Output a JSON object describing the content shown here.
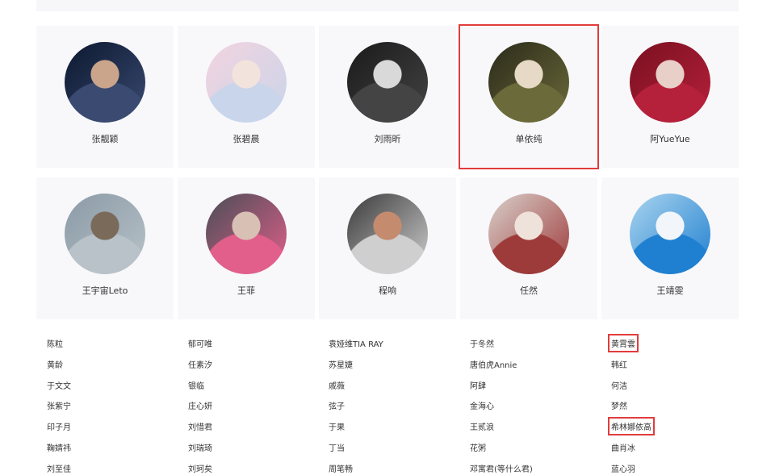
{
  "accent_highlight": "#e23c3c",
  "featured_row_1": [
    {
      "name": "张靓颖",
      "avatar_colors": [
        "#0b1830",
        "#3a4a70",
        "#caa58b"
      ]
    },
    {
      "name": "张碧晨",
      "avatar_colors": [
        "#f3d3df",
        "#c9d5ea",
        "#f2e3dd"
      ]
    },
    {
      "name": "刘雨昕",
      "avatar_colors": [
        "#1a1a1a",
        "#444444",
        "#d9d9d9"
      ]
    },
    {
      "name": "单依纯",
      "avatar_colors": [
        "#2b2a1a",
        "#6b6a3a",
        "#e6d9c6"
      ],
      "selected": true
    },
    {
      "name": "阿YueYue",
      "avatar_colors": [
        "#7a1020",
        "#b5203a",
        "#e8cfc8"
      ]
    }
  ],
  "featured_row_2": [
    {
      "name": "王宇宙Leto",
      "avatar_colors": [
        "#8a9aa6",
        "#b8c2c8",
        "#7a6a5a"
      ]
    },
    {
      "name": "王菲",
      "avatar_colors": [
        "#4a4e57",
        "#e15f8a",
        "#d9c0b5"
      ]
    },
    {
      "name": "程响",
      "avatar_colors": [
        "#3a3a3a",
        "#cfcfcf",
        "#c58b6e"
      ]
    },
    {
      "name": "任然",
      "avatar_colors": [
        "#d9d0cb",
        "#9d3a3a",
        "#efe2db"
      ]
    },
    {
      "name": "王靖雯",
      "avatar_colors": [
        "#a9d4ee",
        "#1f7fd0",
        "#f2f6fa"
      ]
    }
  ],
  "name_columns": [
    [
      "陈粒",
      "黄龄",
      "于文文",
      "张紫宁",
      "印子月",
      "鞠婧祎",
      "刘至佳"
    ],
    [
      "郁可唯",
      "任素汐",
      "银临",
      "庄心妍",
      "刘惜君",
      "刘瑞琦",
      "刘珂矣"
    ],
    [
      "袁娅维TIA RAY",
      "苏星婕",
      "戚薇",
      "弦子",
      "于果",
      "丁当",
      "周笔畅"
    ],
    [
      "于冬然",
      "唐伯虎Annie",
      "阿肆",
      "金海心",
      "王贰浪",
      "花粥",
      "邓寓君(等什么君)"
    ],
    [
      "黄霄雲",
      "韩红",
      "何洁",
      "梦然",
      "希林娜依高",
      "曲肖冰",
      "蓝心羽"
    ]
  ],
  "boxed_names": [
    "黄霄雲",
    "希林娜依高"
  ]
}
